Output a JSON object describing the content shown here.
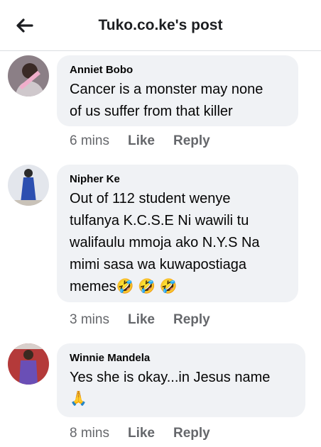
{
  "header": {
    "title": "Tuko.co.ke's post"
  },
  "comments": [
    {
      "author": "Anniet Bobo",
      "text": "Cancer is a monster may none\nof us suffer from that killer",
      "emoji": "",
      "time": "6 mins",
      "like_label": "Like",
      "reply_label": "Reply"
    },
    {
      "author": "Nipher Ke",
      "text": "Out of 112 student wenye\ntulfanya K.C.S.E Ni wawili tu\nwalifaulu mmoja ako N.Y.S Na\nmimi sasa wa kuwapostiaga\nmemes",
      "emoji": "🤣 🤣 🤣",
      "time": "3 mins",
      "like_label": "Like",
      "reply_label": "Reply"
    },
    {
      "author": "Winnie Mandela",
      "text": "Yes she is okay...in Jesus name",
      "emoji": "🙏",
      "time": "8 mins",
      "like_label": "Like",
      "reply_label": "Reply"
    }
  ],
  "colors": {
    "bubble": "#f0f2f5",
    "meta_text": "#65676b"
  }
}
